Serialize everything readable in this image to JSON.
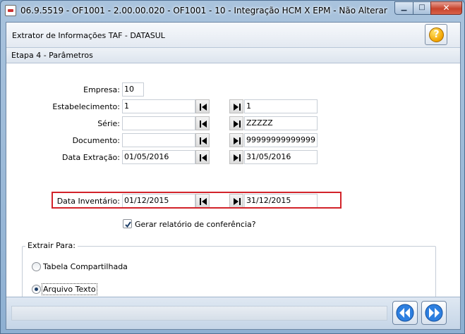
{
  "window": {
    "title": "06.9.5519 - OF1001 - 2.00.00.020 - OF1001 - 10 - Integração HCM X EPM - Não Alterar",
    "minimize_glyph": "▁",
    "maximize_glyph": "□",
    "close_glyph": "✕"
  },
  "header": {
    "title": "Extrator de Informações TAF - DATASUL",
    "help_glyph": "?"
  },
  "step": {
    "label": "Etapa 4 - Parâmetros"
  },
  "form": {
    "empresa": {
      "label": "Empresa:",
      "value": "10"
    },
    "estabelecimento": {
      "label": "Estabelecimento:",
      "from": "1",
      "to": "1"
    },
    "serie": {
      "label": "Série:",
      "from": "",
      "to": "ZZZZZ"
    },
    "documento": {
      "label": "Documento:",
      "from": "",
      "to": "99999999999999"
    },
    "data_extracao": {
      "label": "Data Extração:",
      "from": "01/05/2016",
      "to": "31/05/2016"
    },
    "data_inventario": {
      "label": "Data Inventário:",
      "from": "01/12/2015",
      "to": "31/12/2015"
    },
    "gerar_relatorio": {
      "label": "Gerar relatório de conferência?",
      "checked": true
    }
  },
  "extrair": {
    "title": "Extrair Para:",
    "options": [
      {
        "label": "Tabela Compartilhada",
        "checked": false
      },
      {
        "label": "Arquivo Texto",
        "checked": true
      }
    ]
  },
  "colors": {
    "highlight": "#d2232a",
    "wizard_arrow": "#1d6fd6"
  },
  "icons": {
    "first": "first-record-icon",
    "last": "last-record-icon",
    "back": "double-left-arrow-icon",
    "next": "double-right-arrow-icon"
  }
}
